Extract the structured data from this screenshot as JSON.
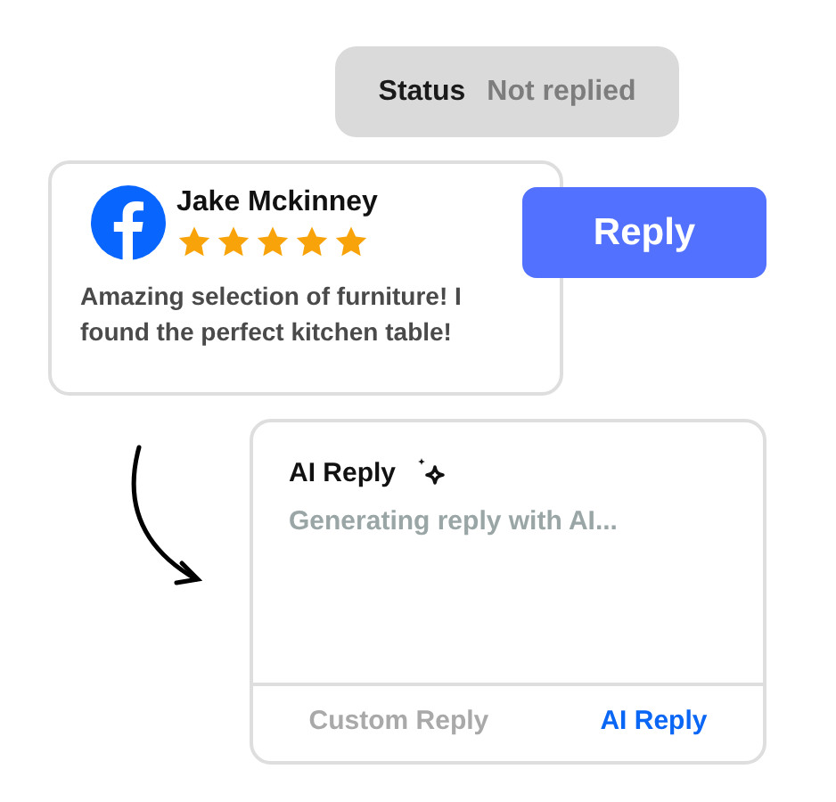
{
  "status": {
    "label": "Status",
    "value": "Not replied"
  },
  "review": {
    "author": "Jake Mckinney",
    "stars": 5,
    "text": "Amazing selection of furniture! I found the perfect kitchen table!"
  },
  "reply_button": {
    "label": "Reply"
  },
  "ai_reply": {
    "title": "AI Reply",
    "placeholder": "Generating reply with AI...",
    "tabs": [
      {
        "label": "Custom Reply",
        "selected": false
      },
      {
        "label": "AI Reply",
        "selected": true
      }
    ]
  }
}
